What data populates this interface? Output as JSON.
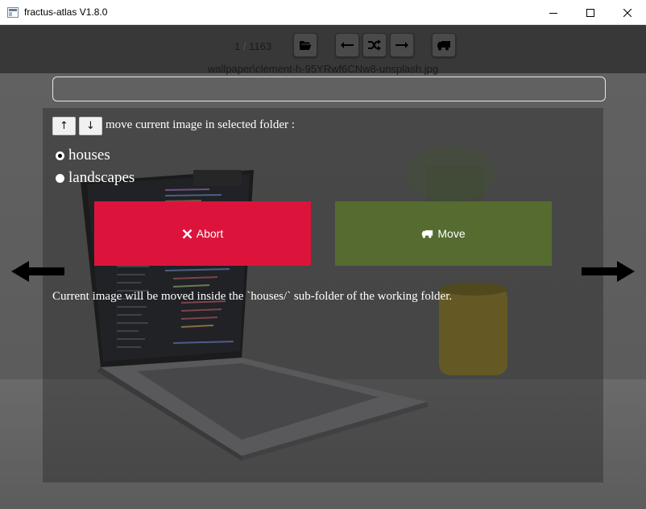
{
  "window": {
    "title": "fractus-atlas V1.8.0"
  },
  "toolbar": {
    "current": "1",
    "separator": "/",
    "total": "1163"
  },
  "filename": "wallpaper\\clement-h-95YRwf6CNw8-unsplash.jpg",
  "search": {
    "value": ""
  },
  "panel": {
    "up_label": "↑",
    "down_label": "↓",
    "move_label": "move current image in selected folder :",
    "folders": [
      {
        "label": "houses",
        "selected": true
      },
      {
        "label": "landscapes",
        "selected": false
      }
    ],
    "abort_label": "Abort",
    "move_button_label": "Move",
    "info": "Current image will be moved inside the `houses/` sub-folder of the working folder."
  },
  "colors": {
    "abort": "#dc143c",
    "move": "#556b2f"
  }
}
